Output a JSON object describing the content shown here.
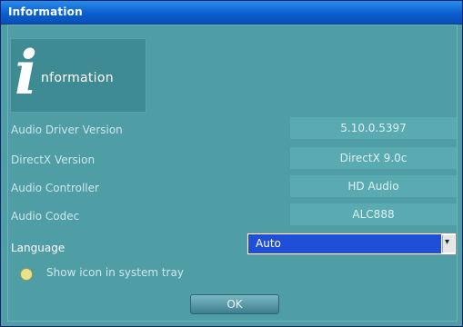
{
  "window": {
    "title": "Information"
  },
  "logo": {
    "big_letter": "i",
    "word": "nformation"
  },
  "rows": [
    {
      "label": "Audio Driver Version",
      "value": "5.10.0.5397"
    },
    {
      "label": "DirectX Version",
      "value": "DirectX 9.0c"
    },
    {
      "label": "Audio Controller",
      "value": "HD Audio"
    },
    {
      "label": "Audio Codec",
      "value": "ALC888"
    }
  ],
  "language": {
    "label": "Language",
    "selected": "Auto",
    "dropdown_icon": "chevron-down-icon"
  },
  "option": {
    "label": "Show icon in system tray"
  },
  "ok_button": {
    "label": "OK"
  },
  "colors": {
    "background": "#4f9ea6",
    "titlebar": "#0a5fd0",
    "select_highlight": "#1f4fd6"
  }
}
